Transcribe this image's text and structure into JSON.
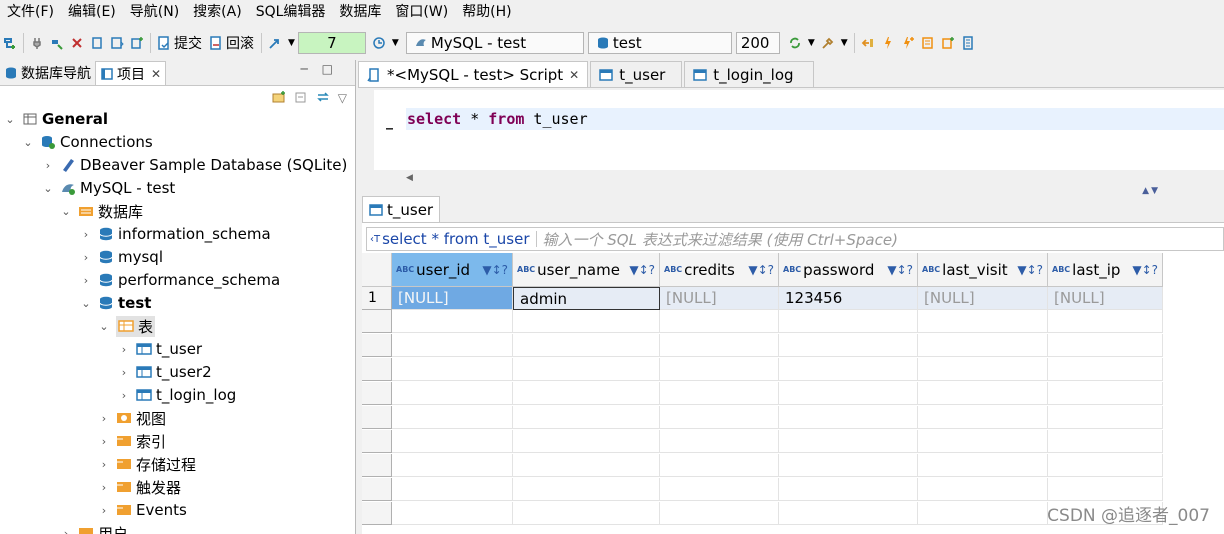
{
  "menu": [
    "文件(F)",
    "编辑(E)",
    "导航(N)",
    "搜索(A)",
    "SQL编辑器",
    "数据库",
    "窗口(W)",
    "帮助(H)"
  ],
  "toolbar": {
    "commit_label": "提交",
    "rollback_label": "回滚",
    "fetch_size": "7",
    "connection": "MySQL - test",
    "schema": "test",
    "result_limit": "200"
  },
  "left_panel": {
    "tab_db_nav": "数据库导航",
    "tab_projects": "项目",
    "tree": {
      "general": "General",
      "connections": "Connections",
      "sample_db": "DBeaver Sample Database (SQLite)",
      "mysql_test": "MySQL - test",
      "databases": "数据库",
      "information_schema": "information_schema",
      "mysql": "mysql",
      "performance_schema": "performance_schema",
      "test": "test",
      "tables": "表",
      "t_user": "t_user",
      "t_user2": "t_user2",
      "t_login_log": "t_login_log",
      "views": "视图",
      "indexes": "索引",
      "procedures": "存储过程",
      "triggers": "触发器",
      "events": "Events",
      "users": "用户"
    }
  },
  "editor": {
    "tabs": [
      "*<MySQL - test> Script",
      "t_user",
      "t_login_log"
    ],
    "sql": {
      "kw1": "select",
      "star": " * ",
      "kw2": "from",
      "table": " t_user"
    },
    "result_tab": "t_user",
    "filter_query": "select * from t_user",
    "filter_placeholder": "输入一个 SQL 表达式来过滤结果 (使用 Ctrl+Space)",
    "columns": [
      "user_id",
      "user_name",
      "credits",
      "password",
      "last_visit",
      "last_ip"
    ],
    "rows": [
      {
        "num": "1",
        "cells": [
          "[NULL]",
          "admin",
          "[NULL]",
          "123456",
          "[NULL]",
          "[NULL]"
        ]
      }
    ]
  },
  "watermark": "CSDN @追逐者_007",
  "colors": {
    "selection": "#6fa9e3",
    "keyword": "#7f0055",
    "link_blue": "#1a46a8"
  }
}
